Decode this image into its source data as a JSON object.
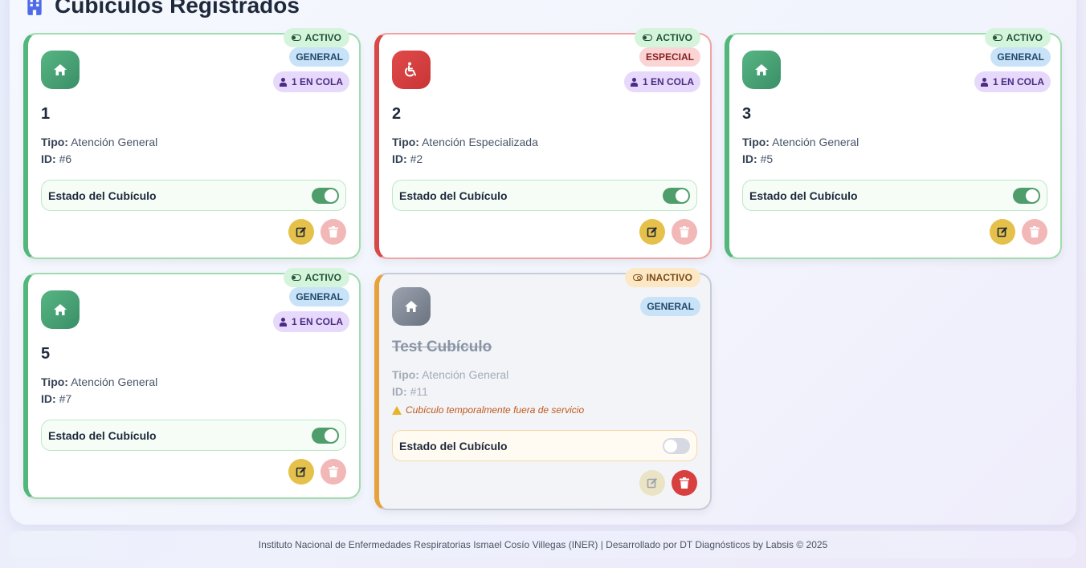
{
  "section": {
    "title": "Cubículos Registrados",
    "icon": "building-icon"
  },
  "labels": {
    "tipo": "Tipo:",
    "id": "ID:",
    "state": "Estado del Cubículo"
  },
  "cards": [
    {
      "name": "1",
      "status": "ACTIVO",
      "type_badge": "GENERAL",
      "queue": "1 EN COLA",
      "tipo": "Atención General",
      "id": "#6",
      "enabled": true,
      "icon": "home-icon",
      "color": "#52b77b"
    },
    {
      "name": "2",
      "status": "ACTIVO",
      "type_badge": "ESPECIAL",
      "queue": "1 EN COLA",
      "tipo": "Atención Especializada",
      "id": "#2",
      "enabled": true,
      "icon": "wheelchair-icon",
      "color": "#d94848"
    },
    {
      "name": "3",
      "status": "ACTIVO",
      "type_badge": "GENERAL",
      "queue": "1 EN COLA",
      "tipo": "Atención General",
      "id": "#5",
      "enabled": true,
      "icon": "home-icon",
      "color": "#52b77b"
    },
    {
      "name": "5",
      "status": "ACTIVO",
      "type_badge": "GENERAL",
      "queue": "1 EN COLA",
      "tipo": "Atención General",
      "id": "#7",
      "enabled": true,
      "icon": "home-icon",
      "color": "#52b77b"
    },
    {
      "name": "Test Cubículo",
      "status": "INACTIVO",
      "type_badge": "GENERAL",
      "tipo": "Atención General",
      "id": "#11",
      "warning": "Cubículo temporalmente fuera de servicio",
      "enabled": false,
      "icon": "home-icon",
      "color": "#e8a23b"
    }
  ],
  "footer": {
    "text": "Instituto Nacional de Enfermedades Respiratorias Ismael Cosío Villegas (INER) | Desarrollado por DT Diagnósticos by Labsis © 2025"
  }
}
